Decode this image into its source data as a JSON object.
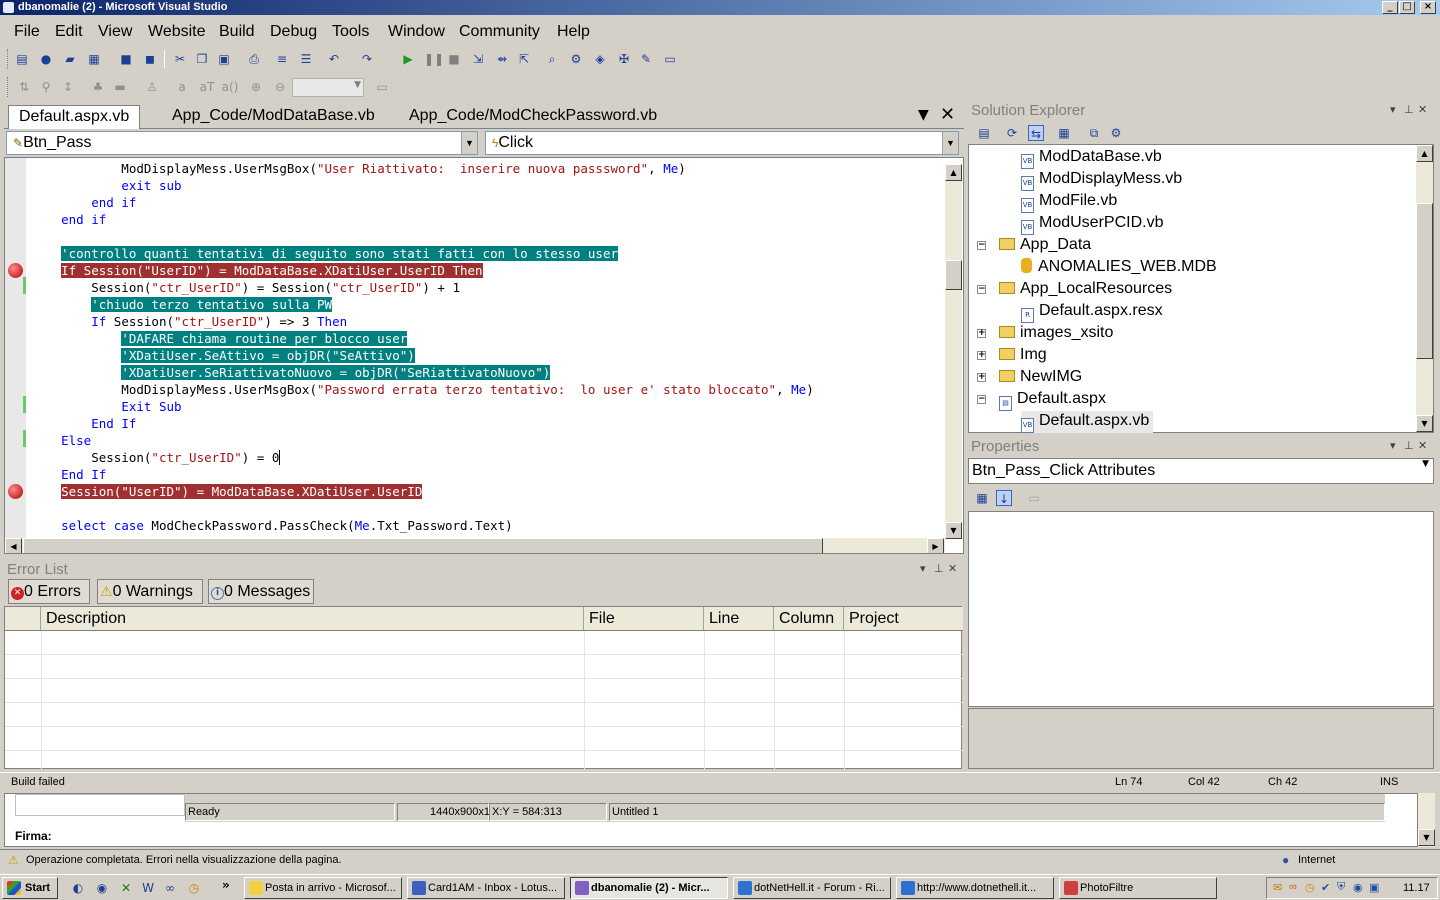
{
  "window": {
    "title": "dbanomalie (2) - Microsoft Visual Studio"
  },
  "menu": [
    "File",
    "Edit",
    "View",
    "Website",
    "Build",
    "Debug",
    "Tools",
    "Window",
    "Community",
    "Help"
  ],
  "tabs": [
    "Default.aspx.vb",
    "App_Code/ModDataBase.vb",
    "App_Code/ModCheckPassword.vb"
  ],
  "editor": {
    "object_combo": "Btn_Pass",
    "method_combo": "Click",
    "lines": [
      "            ModDisplayMess.UserMsgBox(\"User Riattivato:  inserire nuova passsword\", Me)",
      "            exit sub",
      "        end if",
      "    end if",
      "",
      "    'controllo quanti tentativi di seguito sono stati fatti con lo stesso user",
      "    If Session(\"UserID\") = ModDataBase.XDatiUser.UserID Then",
      "        Session(\"ctr_UserID\") = Session(\"ctr_UserID\") + 1",
      "        'chiudo terzo tentativo sulla PW",
      "        If Session(\"ctr_UserID\") => 3 Then",
      "            'DAFARE chiama routine per blocco user",
      "            'XDatiUser.SeAttivo = objDR(\"SeAttivo\")",
      "            'XDatiUser.SeRiattivatoNuovo = objDR(\"SeRiattivatoNuovo\")",
      "            ModDisplayMess.UserMsgBox(\"Password errata terzo tentativo:  lo user e' stato bloccato\", Me)",
      "            Exit Sub",
      "        End If",
      "    Else",
      "        Session(\"ctr_UserID\") = 0",
      "    End If",
      "    Session(\"UserID\") = ModDataBase.XDatiUser.UserID",
      "",
      "    select case ModCheckPassword.PassCheck(Me.Txt_Password.Text)"
    ]
  },
  "error_list": {
    "title": "Error List",
    "errors": "0 Errors",
    "warnings": "0 Warnings",
    "messages": "0 Messages",
    "columns": [
      "Description",
      "File",
      "Line",
      "Column",
      "Project"
    ]
  },
  "solution_explorer": {
    "title": "Solution Explorer",
    "items": [
      "ModDataBase.vb",
      "ModDisplayMess.vb",
      "ModFile.vb",
      "ModUserPCID.vb",
      "App_Data",
      "ANOMALIES_WEB.MDB",
      "App_LocalResources",
      "Default.aspx.resx",
      "images_xsito",
      "Img",
      "NewIMG",
      "Default.aspx",
      "Default.aspx.vb"
    ]
  },
  "properties": {
    "title": "Properties",
    "object_name": "Btn_Pass_Click",
    "object_type": "Attributes"
  },
  "statusbar": {
    "message": "Build failed",
    "ln": "Ln 74",
    "col": "Col 42",
    "ch": "Ch 42",
    "mode": "INS"
  },
  "background": {
    "ready": "Ready",
    "resolution": "1440x900x16M",
    "xy": "X:Y = 584:313",
    "untitled": "Untitled 1",
    "firma": "Firma:",
    "ie_status": "Operazione completata. Errori nella visualizzazione della pagina.",
    "zone": "Internet"
  },
  "taskbar": {
    "start": "Start",
    "tasks": [
      "Posta in arrivo - Microsof...",
      "Card1AM - Inbox - Lotus...",
      "dbanomalie (2) - Micr...",
      "dotNetHell.it - Forum - Ri...",
      "http://www.dotnethell.it...",
      "PhotoFiltre"
    ],
    "clock": "11.17",
    "chevron": "»"
  }
}
